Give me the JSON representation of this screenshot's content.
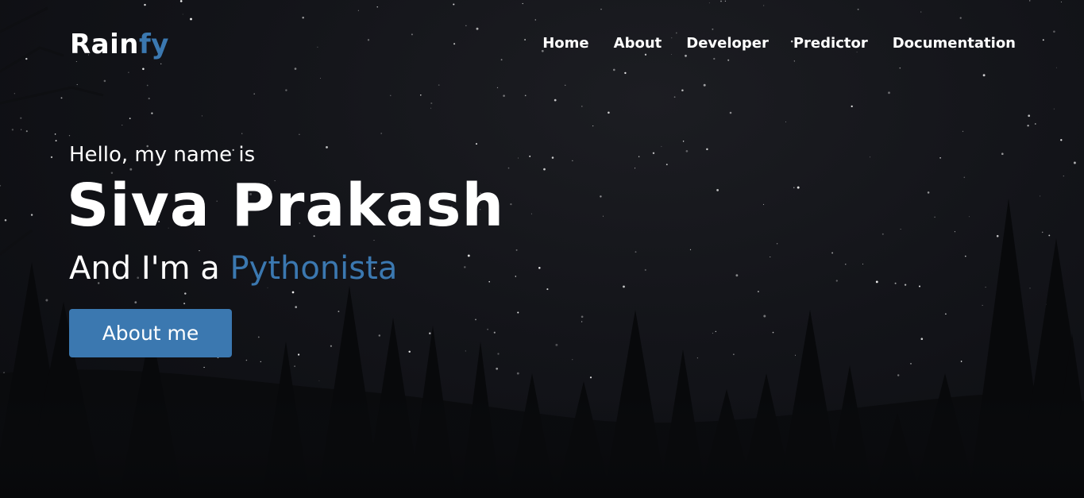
{
  "brand": {
    "name_main": "Rain",
    "name_accent": "fy"
  },
  "nav": {
    "items": [
      {
        "label": "Home"
      },
      {
        "label": "About"
      },
      {
        "label": "Developer"
      },
      {
        "label": "Predictor"
      },
      {
        "label": "Documentation"
      }
    ]
  },
  "hero": {
    "greeting": "Hello, my name is",
    "name": "Siva Prakash",
    "role_prefix": "And I'm a ",
    "role_highlight": "Pythonista",
    "cta_label": "About me",
    "background": "starry-night-forest-photo"
  },
  "colors": {
    "accent": "#3b78b0",
    "text": "#ffffff",
    "background": "#0b0c10"
  }
}
